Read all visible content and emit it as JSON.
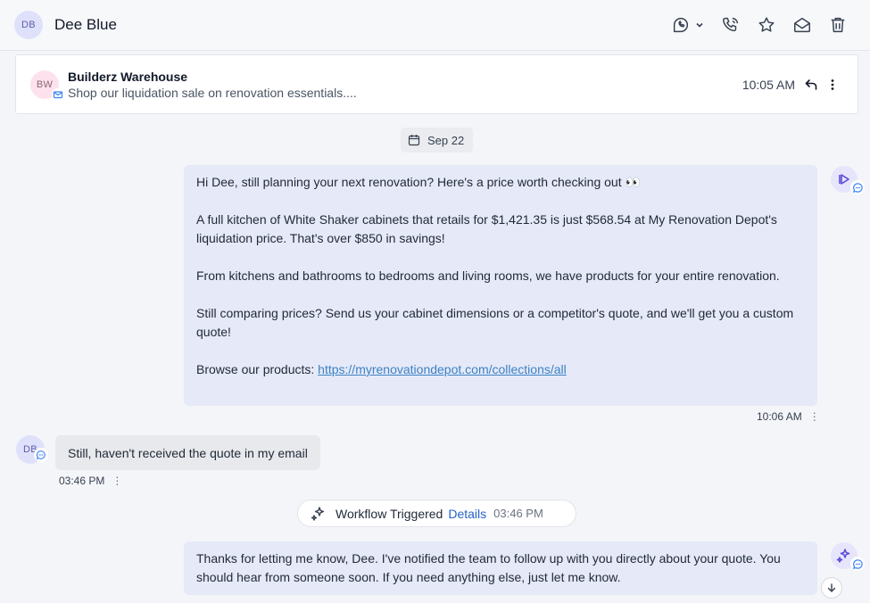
{
  "header": {
    "avatar_initials": "DB",
    "contact_name": "Dee Blue",
    "icons": [
      "call-dropdown-icon",
      "phone-icon",
      "star-icon",
      "mail-icon",
      "trash-icon"
    ]
  },
  "email_preview": {
    "avatar_initials": "BW",
    "sender": "Builderz Warehouse",
    "subject": "Shop our liquidation sale on renovation essentials....",
    "time": "10:05 AM"
  },
  "date_separator": "Sep 22",
  "messages": [
    {
      "direction": "outbound",
      "paragraphs": [
        "Hi Dee, still planning your next renovation? Here's a price worth checking out 👀",
        "A full kitchen of White Shaker cabinets that retails for $1,421.35 is just $568.54 at My Renovation Depot's liquidation price. That's over $850 in savings!",
        "From kitchens and bathrooms to bedrooms and living rooms, we have products for your entire renovation.",
        "Still comparing prices? Send us your cabinet dimensions or a competitor's quote, and we'll get you a custom quote!"
      ],
      "link_prefix": "Browse our products: ",
      "link_text": "https://myrenovationdepot.com/collections/all",
      "time": "10:06 AM"
    },
    {
      "direction": "inbound",
      "avatar_initials": "DB",
      "text": "Still, haven't received the quote in my email",
      "time": "03:46 PM"
    },
    {
      "direction": "outbound",
      "text": "Thanks for letting me know, Dee. I've notified the team to follow up with you directly about your quote. You should hear from someone soon. If you need anything else, just let me know."
    }
  ],
  "workflow": {
    "label": "Workflow Triggered",
    "details_label": "Details",
    "time": "03:46 PM"
  },
  "menu_glyph": "⋮",
  "colors": {
    "outbound_bubble": "#e6e9f8",
    "inbound_bubble": "#e8e9ec",
    "link": "#3b82c4",
    "accent": "#2563c9"
  }
}
